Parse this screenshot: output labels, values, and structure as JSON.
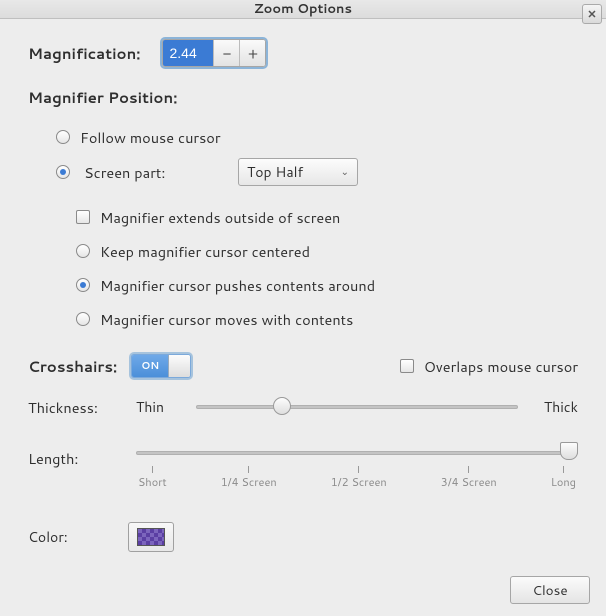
{
  "title": "Zoom Options",
  "magnification": {
    "label": "Magnification:",
    "value": "2.44"
  },
  "magnifier_position": {
    "heading": "Magnifier Position:",
    "follow": "Follow mouse cursor",
    "screen_part_label": "Screen part:",
    "screen_part_selected": "Top Half",
    "extends_outside": "Magnifier extends outside of screen",
    "keep_centered": "Keep magnifier cursor centered",
    "pushes_around": "Magnifier cursor pushes contents around",
    "moves_with": "Magnifier cursor moves with contents"
  },
  "crosshairs": {
    "label": "Crosshairs:",
    "state": "ON",
    "overlaps_label": "Overlaps mouse cursor",
    "thickness_label": "Thickness:",
    "thin": "Thin",
    "thick": "Thick",
    "length_label": "Length:",
    "ticks": [
      "Short",
      "1/4 Screen",
      "1/2 Screen",
      "3/4 Screen",
      "Long"
    ],
    "color_label": "Color:"
  },
  "buttons": {
    "close": "Close"
  }
}
